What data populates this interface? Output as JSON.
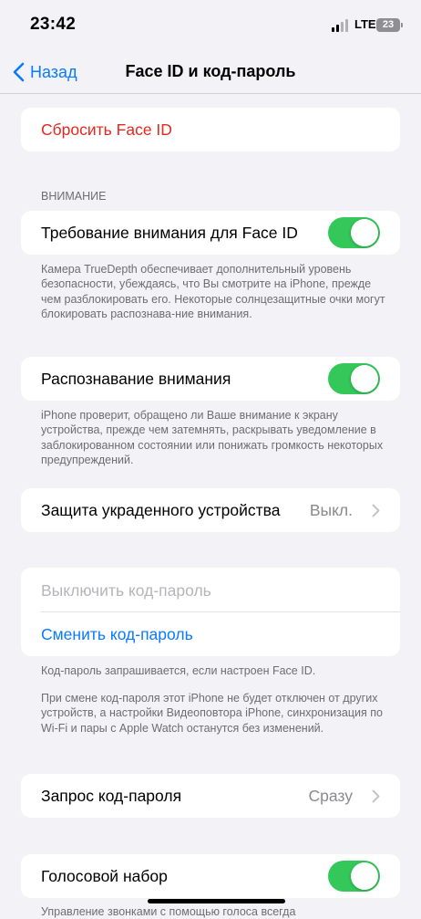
{
  "status_bar": {
    "time": "23:42",
    "network": "LTE",
    "battery": "23"
  },
  "nav": {
    "back_label": "Назад",
    "title": "Face ID и код-пароль"
  },
  "reset_face_id": {
    "label": "Сбросить Face ID"
  },
  "attention": {
    "header": "ВНИМАНИЕ",
    "require_attention": {
      "label": "Требование внимания для Face ID",
      "on": true
    },
    "require_attention_footer": "Камера TrueDepth обеспечивает дополнительный уровень безопасности, убеждаясь, что Вы смотрите на iPhone, прежде чем разблокировать его. Некоторые солнцезащитные очки могут блокировать распознава-ние внимания.",
    "aware_features": {
      "label": "Распознавание внимания",
      "on": true
    },
    "aware_features_footer": "iPhone проверит, обращено ли Ваше внимание к экрану устройства, прежде чем затемнять, раскрывать уведомление в заблокированном состоянии или понижать громкость некоторых предупреждений."
  },
  "stolen_device": {
    "label": "Защита украденного устройства",
    "value": "Выкл."
  },
  "passcode": {
    "turn_off_label": "Выключить код-пароль",
    "change_label": "Сменить код-пароль",
    "footer_1": "Код-пароль запрашивается, если настроен Face ID.",
    "footer_2": "При смене код-пароля этот iPhone не будет отключен от других устройств, а настройки Видеоповтора iPhone, синхронизация по Wi-Fi и пары с Apple Watch останутся без изменений."
  },
  "require_passcode": {
    "label": "Запрос код-пароля",
    "value": "Сразу"
  },
  "voice_dial": {
    "label": "Голосовой набор",
    "on": true,
    "footer_partial": "Управление звонками с помощью голоса всегда"
  },
  "colors": {
    "accent": "#0a7aff",
    "destructive": "#e5281f",
    "toggle_on": "#34c759",
    "background": "#f2f2f7"
  }
}
